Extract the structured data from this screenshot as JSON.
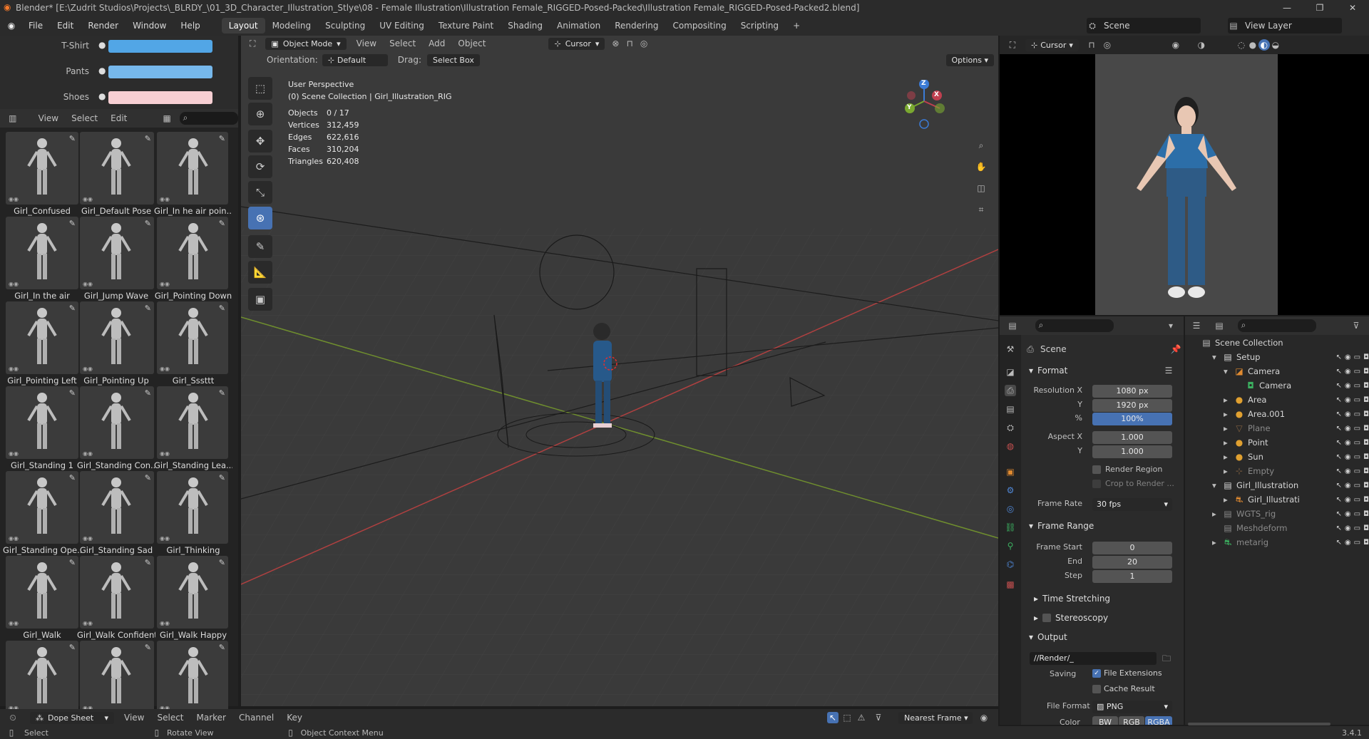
{
  "window": {
    "title": "Blender* [E:\\Zudrit Studios\\Projects\\_BLRDY_\\01_3D_Character_Illustration_Stlye\\08 - Female Illustration\\Illustration Female_RIGGED-Posed-Packed\\Illustration Female_RIGGED-Posed-Packed2.blend]",
    "minimize": "—",
    "maximize": "❐",
    "close": "✕"
  },
  "menu": {
    "items": [
      "File",
      "Edit",
      "Render",
      "Window",
      "Help"
    ],
    "workspaces": [
      "Layout",
      "Modeling",
      "Sculpting",
      "UV Editing",
      "Texture Paint",
      "Shading",
      "Animation",
      "Rendering",
      "Compositing",
      "Scripting"
    ],
    "add_tab": "+",
    "scene_name": "Scene",
    "view_layer": "View Layer"
  },
  "colors_panel": {
    "rows": [
      {
        "label": "T-Shirt",
        "color": "#52a6e6"
      },
      {
        "label": "Pants",
        "color": "#76b8ec"
      },
      {
        "label": "Shoes",
        "color": "#f7cfd3"
      }
    ]
  },
  "asset_browser": {
    "menus": [
      "View",
      "Select",
      "Edit"
    ],
    "items": [
      "Girl_Confused",
      "Girl_Default Pose",
      "Girl_In he air poin...",
      "Girl_In the air",
      "Girl_Jump Wave",
      "Girl_Pointing Down",
      "Girl_Pointing Left",
      "Girl_Pointing Up",
      "Girl_Sssttt",
      "Girl_Standing 1",
      "Girl_Standing Con...",
      "Girl_Standing Lea...",
      "Girl_Standing Ope...",
      "Girl_Standing Sad",
      "Girl_Thinking",
      "Girl_Walk",
      "Girl_Walk Confident",
      "Girl_Walk Happy",
      "",
      "",
      ""
    ]
  },
  "viewport": {
    "mode": "Object Mode",
    "menus": [
      "View",
      "Select",
      "Add",
      "Object"
    ],
    "transform_orientation": "Cursor",
    "orientation_label": "Orientation:",
    "orientation_value": "Default",
    "drag_label": "Drag:",
    "drag_value": "Select Box",
    "options": "Options",
    "perspective": "User Perspective",
    "collection": "(0) Scene Collection | Girl_Illustration_RIG",
    "stats": [
      {
        "label": "Objects",
        "value": "0 / 17"
      },
      {
        "label": "Vertices",
        "value": "312,459"
      },
      {
        "label": "Edges",
        "value": "622,616"
      },
      {
        "label": "Faces",
        "value": "310,204"
      },
      {
        "label": "Triangles",
        "value": "620,408"
      }
    ],
    "gizmo_axes": [
      "Z",
      "Y",
      "X"
    ]
  },
  "camera_view": {
    "pivot": "Cursor",
    "shirt_color": "#2c6ea8",
    "pants_color": "#2e5b86"
  },
  "properties": {
    "context": "Scene",
    "format": {
      "header": "Format",
      "resolution_x_label": "Resolution X",
      "resolution_x": "1080 px",
      "y_label": "Y",
      "resolution_y": "1920 px",
      "pct_label": "%",
      "pct": "100%",
      "aspect_x_label": "Aspect X",
      "aspect_x": "1.000",
      "aspect_y": "1.000",
      "render_region": "Render Region",
      "crop": "Crop to Render ...",
      "frame_rate_label": "Frame Rate",
      "frame_rate": "30 fps"
    },
    "frame_range": {
      "header": "Frame Range",
      "start_label": "Frame Start",
      "start": "0",
      "end_label": "End",
      "end": "20",
      "step_label": "Step",
      "step": "1"
    },
    "time_stretching": "Time Stretching",
    "stereoscopy": "Stereoscopy",
    "output": {
      "header": "Output",
      "path": "//Render/_",
      "saving_label": "Saving",
      "file_extensions": "File Extensions",
      "cache_result": "Cache Result",
      "file_format_label": "File Format",
      "file_format": "PNG",
      "color_label": "Color",
      "color_modes": [
        "BW",
        "RGB",
        "RGBA"
      ]
    }
  },
  "outliner": {
    "root": "Scene Collection",
    "rows": [
      {
        "name": "Setup",
        "indent": 1,
        "expanded": "▾",
        "type": "collection"
      },
      {
        "name": "Camera",
        "indent": 2,
        "expanded": "▾",
        "type": "camera"
      },
      {
        "name": "Camera",
        "indent": 3,
        "expanded": "",
        "type": "cameradata"
      },
      {
        "name": "Area",
        "indent": 2,
        "expanded": "▸",
        "type": "light"
      },
      {
        "name": "Area.001",
        "indent": 2,
        "expanded": "▸",
        "type": "light"
      },
      {
        "name": "Plane",
        "indent": 2,
        "expanded": "▸",
        "type": "mesh-dim"
      },
      {
        "name": "Point",
        "indent": 2,
        "expanded": "▸",
        "type": "light"
      },
      {
        "name": "Sun",
        "indent": 2,
        "expanded": "▸",
        "type": "light"
      },
      {
        "name": "Empty",
        "indent": 2,
        "expanded": "▸",
        "type": "empty-dim"
      },
      {
        "name": "Girl_Illustration",
        "indent": 1,
        "expanded": "▾",
        "type": "collection"
      },
      {
        "name": "Girl_Illustrati",
        "indent": 2,
        "expanded": "▸",
        "type": "armature"
      },
      {
        "name": "WGTS_rig",
        "indent": 1,
        "expanded": "▸",
        "type": "collection-dim"
      },
      {
        "name": "Meshdeform",
        "indent": 1,
        "expanded": "",
        "type": "collection-dim"
      },
      {
        "name": "metarig",
        "indent": 1,
        "expanded": "▸",
        "type": "armature-dim"
      }
    ]
  },
  "timeline": {
    "editor": "Dope Sheet",
    "menus": [
      "View",
      "Select",
      "Marker",
      "Channel",
      "Key"
    ],
    "snap": "Nearest Frame"
  },
  "statusbar": {
    "select": "Select",
    "rotate": "Rotate View",
    "context_menu": "Object Context Menu",
    "version": "3.4.1"
  }
}
